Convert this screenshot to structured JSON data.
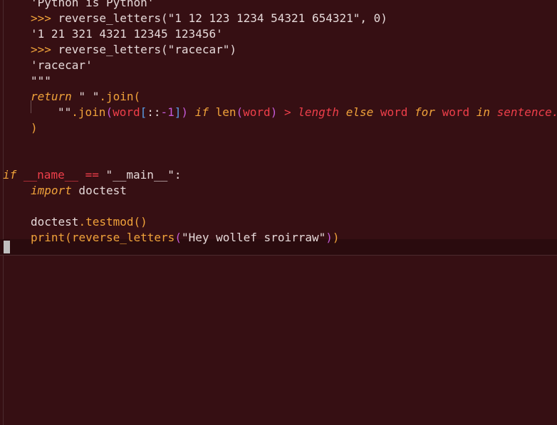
{
  "editor": {
    "lines": [
      {
        "row": 0,
        "indent": 1,
        "tokens": [
          {
            "t": "'Python is Python'",
            "c": "t-text"
          }
        ]
      },
      {
        "row": 1,
        "indent": 1,
        "tokens": [
          {
            "t": ">>> ",
            "c": "t-prompt"
          },
          {
            "t": "reverse_letters(\"1 12 123 1234 54321 654321\", 0)",
            "c": "t-text"
          }
        ]
      },
      {
        "row": 2,
        "indent": 1,
        "tokens": [
          {
            "t": "'1 21 321 4321 12345 123456'",
            "c": "t-text"
          }
        ]
      },
      {
        "row": 3,
        "indent": 1,
        "tokens": [
          {
            "t": ">>> ",
            "c": "t-prompt"
          },
          {
            "t": "reverse_letters(\"racecar\")",
            "c": "t-text"
          }
        ]
      },
      {
        "row": 4,
        "indent": 1,
        "tokens": [
          {
            "t": "'racecar'",
            "c": "t-text"
          }
        ]
      },
      {
        "row": 5,
        "indent": 1,
        "tokens": [
          {
            "t": "\"\"\"",
            "c": "t-text"
          }
        ]
      },
      {
        "row": 6,
        "indent": 1,
        "tokens": [
          {
            "t": "return",
            "c": "t-keyword"
          },
          {
            "t": " \" \"",
            "c": "t-text"
          },
          {
            "t": ".join",
            "c": "t-func"
          },
          {
            "t": "(",
            "c": "t-paren"
          }
        ]
      },
      {
        "row": 7,
        "indent": 2,
        "tokens": [
          {
            "t": "\"\"",
            "c": "t-text"
          },
          {
            "t": ".join",
            "c": "t-func"
          },
          {
            "t": "(",
            "c": "t-paren2"
          },
          {
            "t": "word",
            "c": "t-var"
          },
          {
            "t": "[",
            "c": "t-paren3"
          },
          {
            "t": "::",
            "c": "t-text"
          },
          {
            "t": "-1",
            "c": "t-num"
          },
          {
            "t": "]",
            "c": "t-paren3"
          },
          {
            "t": ")",
            "c": "t-paren2"
          },
          {
            "t": " ",
            "c": "t-text"
          },
          {
            "t": "if",
            "c": "t-keyword"
          },
          {
            "t": " ",
            "c": "t-text"
          },
          {
            "t": "len",
            "c": "t-func"
          },
          {
            "t": "(",
            "c": "t-paren2"
          },
          {
            "t": "word",
            "c": "t-var"
          },
          {
            "t": ")",
            "c": "t-paren2"
          },
          {
            "t": " ",
            "c": "t-text"
          },
          {
            "t": ">",
            "c": "t-op"
          },
          {
            "t": " ",
            "c": "t-text"
          },
          {
            "t": "length",
            "c": "t-keyword-red"
          },
          {
            "t": " ",
            "c": "t-text"
          },
          {
            "t": "else",
            "c": "t-keyword"
          },
          {
            "t": " ",
            "c": "t-text"
          },
          {
            "t": "word",
            "c": "t-var"
          },
          {
            "t": " ",
            "c": "t-text"
          },
          {
            "t": "for",
            "c": "t-keyword"
          },
          {
            "t": " ",
            "c": "t-text"
          },
          {
            "t": "word",
            "c": "t-var"
          },
          {
            "t": " ",
            "c": "t-text"
          },
          {
            "t": "in",
            "c": "t-keyword"
          },
          {
            "t": " ",
            "c": "t-text"
          },
          {
            "t": "sentence.",
            "c": "t-keyword-red"
          }
        ]
      },
      {
        "row": 8,
        "indent": 1,
        "tokens": [
          {
            "t": ")",
            "c": "t-paren"
          }
        ]
      },
      {
        "row": 9,
        "indent": 0,
        "tokens": []
      },
      {
        "row": 10,
        "indent": 0,
        "tokens": []
      },
      {
        "row": 11,
        "indent": 0,
        "tokens": [
          {
            "t": "if",
            "c": "t-keyword"
          },
          {
            "t": " ",
            "c": "t-text"
          },
          {
            "t": "__name__",
            "c": "t-dunder"
          },
          {
            "t": " ",
            "c": "t-text"
          },
          {
            "t": "==",
            "c": "t-op"
          },
          {
            "t": " \"__main__\":",
            "c": "t-text"
          }
        ]
      },
      {
        "row": 12,
        "indent": 1,
        "tokens": [
          {
            "t": "import",
            "c": "t-keyword"
          },
          {
            "t": " doctest",
            "c": "t-text"
          }
        ]
      },
      {
        "row": 13,
        "indent": 0,
        "tokens": []
      },
      {
        "row": 14,
        "indent": 1,
        "tokens": [
          {
            "t": "doctest",
            "c": "t-text"
          },
          {
            "t": ".testmod",
            "c": "t-func"
          },
          {
            "t": "()",
            "c": "t-paren"
          }
        ]
      },
      {
        "row": 15,
        "indent": 1,
        "tokens": [
          {
            "t": "print",
            "c": "t-func"
          },
          {
            "t": "(",
            "c": "t-paren"
          },
          {
            "t": "reverse_letters",
            "c": "t-func"
          },
          {
            "t": "(",
            "c": "t-paren2"
          },
          {
            "t": "\"Hey wollef sroirraw\"",
            "c": "t-text"
          },
          {
            "t": ")",
            "c": "t-paren2"
          },
          {
            "t": ")",
            "c": "t-paren"
          }
        ]
      }
    ],
    "cursor_line": 16
  }
}
